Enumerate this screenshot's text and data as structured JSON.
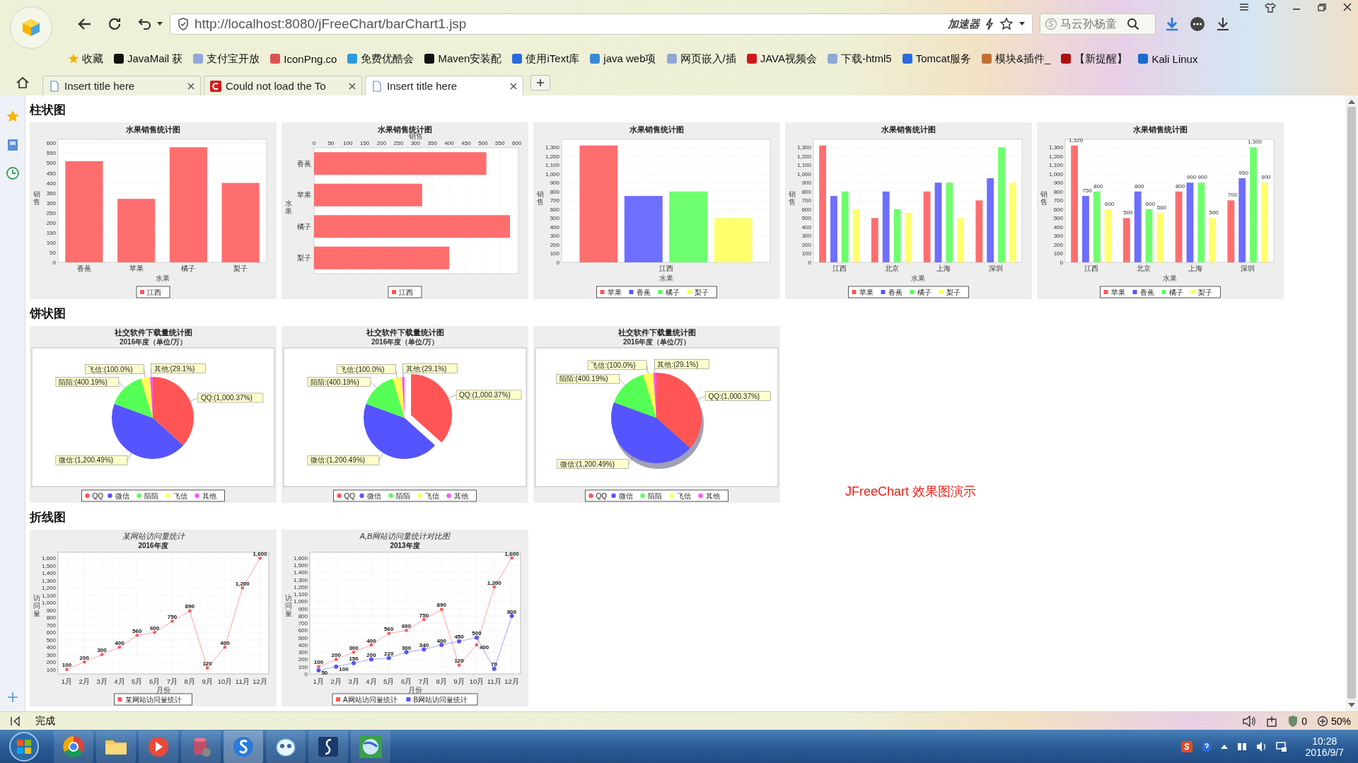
{
  "browser": {
    "address": "http://localhost:8080/jFreeChart/barChart1.jsp",
    "accelerator": "加速器",
    "search": {
      "placeholder": "马云孙杨童"
    },
    "bookmarks": [
      {
        "label": "收藏",
        "kind": "star",
        "color": "#f0b400"
      },
      {
        "label": "JavaMail 获",
        "kind": "site",
        "color": "#111111"
      },
      {
        "label": "支付宝开放",
        "kind": "site",
        "color": "#8fa8d8"
      },
      {
        "label": "IconPng.co",
        "kind": "site",
        "color": "#e05050"
      },
      {
        "label": "免费优酷会",
        "kind": "site",
        "color": "#2a9ae0"
      },
      {
        "label": "Maven安装配",
        "kind": "site",
        "color": "#111111"
      },
      {
        "label": "使用iText库",
        "kind": "site",
        "color": "#2a6ae0"
      },
      {
        "label": "java web项",
        "kind": "site",
        "color": "#3a8ad8"
      },
      {
        "label": "网页嵌入/插",
        "kind": "site",
        "color": "#8fa8d8"
      },
      {
        "label": "JAVA视频会",
        "kind": "site",
        "color": "#d01818"
      },
      {
        "label": "下载-html5",
        "kind": "site",
        "color": "#8fa8d8"
      },
      {
        "label": "Tomcat服务",
        "kind": "site",
        "color": "#2a6ae0"
      },
      {
        "label": "模块&插件_",
        "kind": "site",
        "color": "#c07030"
      },
      {
        "label": "【新提醒】",
        "kind": "site",
        "color": "#b01010"
      },
      {
        "label": "Kali Linux",
        "kind": "site",
        "color": "#1a6ad0"
      }
    ],
    "tabs": [
      {
        "title": "Insert title here",
        "kind": "page",
        "selected": false
      },
      {
        "title": "Could not load the To",
        "kind": "error",
        "selected": false
      },
      {
        "title": "Insert title here",
        "kind": "page",
        "selected": true
      }
    ]
  },
  "sections": [
    {
      "heading": "柱状图",
      "charts": [
        {
          "chart_data": {
            "type": "bar",
            "orientation": "vertical",
            "title": "水果销售统计图",
            "xlabel": "水果",
            "ylabel": "销售",
            "categories": [
              "香蕉",
              "苹果",
              "橘子",
              "梨子"
            ],
            "series": [
              {
                "name": "江西",
                "color": "#ff5555",
                "values": [
                  510,
                  320,
                  580,
                  400
                ]
              }
            ],
            "ylim": [
              0,
              620
            ],
            "yticks": [
              0,
              50,
              100,
              150,
              200,
              250,
              300,
              350,
              400,
              450,
              500,
              550,
              600
            ],
            "grid": true,
            "legend": "bottom"
          }
        },
        {
          "chart_data": {
            "type": "bar",
            "orientation": "horizontal",
            "title": "水果销售统计图",
            "xlabel": "销售",
            "ylabel": "水果",
            "categories": [
              "香蕉",
              "苹果",
              "橘子",
              "梨子"
            ],
            "series": [
              {
                "name": "江西",
                "color": "#ff5555",
                "values": [
                  510,
                  320,
                  580,
                  400
                ]
              }
            ],
            "xlim": [
              0,
              605
            ],
            "xticks": [
              0,
              50,
              100,
              150,
              200,
              250,
              300,
              350,
              400,
              450,
              500,
              550,
              600
            ],
            "grid": true,
            "legend": "bottom"
          }
        },
        {
          "chart_data": {
            "type": "bar",
            "orientation": "vertical",
            "title": "水果销售统计图",
            "xlabel": "水果",
            "ylabel": "销售",
            "categories": [
              "江西"
            ],
            "series": [
              {
                "name": "苹果",
                "color": "#ff5555",
                "values": [
                  1320
                ]
              },
              {
                "name": "香蕉",
                "color": "#5555ff",
                "values": [
                  750
                ]
              },
              {
                "name": "橘子",
                "color": "#55ff55",
                "values": [
                  800
                ]
              },
              {
                "name": "梨子",
                "color": "#ffff55",
                "values": [
                  500
                ]
              }
            ],
            "ylim": [
              0,
              1390
            ],
            "yticks": [
              0,
              100,
              200,
              300,
              400,
              500,
              600,
              700,
              800,
              900,
              {
                "value": 1000,
                "label": "1,000"
              },
              {
                "value": 1100,
                "label": "1,100"
              },
              {
                "value": 1200,
                "label": "1,200"
              },
              {
                "value": 1300,
                "label": "1,300"
              }
            ],
            "grid": true,
            "legend": "bottom"
          }
        },
        {
          "chart_data": {
            "type": "bar",
            "orientation": "vertical",
            "title": "水果销售统计图",
            "xlabel": "水果",
            "ylabel": "销售",
            "categories": [
              "江西",
              "北京",
              "上海",
              "深圳"
            ],
            "series": [
              {
                "name": "苹果",
                "color": "#ff5555",
                "values": [
                  1320,
                  500,
                  800,
                  700
                ]
              },
              {
                "name": "香蕉",
                "color": "#5555ff",
                "values": [
                  750,
                  800,
                  900,
                  950
                ]
              },
              {
                "name": "橘子",
                "color": "#55ff55",
                "values": [
                  800,
                  600,
                  900,
                  1300
                ]
              },
              {
                "name": "梨子",
                "color": "#ffff55",
                "values": [
                  600,
                  560,
                  500,
                  900
                ]
              }
            ],
            "ylim": [
              0,
              1390
            ],
            "yticks": [
              0,
              100,
              200,
              300,
              400,
              500,
              600,
              700,
              800,
              900,
              {
                "value": 1000,
                "label": "1,000"
              },
              {
                "value": 1100,
                "label": "1,100"
              },
              {
                "value": 1200,
                "label": "1,200"
              },
              {
                "value": 1300,
                "label": "1,300"
              }
            ],
            "grid": true,
            "legend": "bottom"
          }
        },
        {
          "chart_data": {
            "type": "bar",
            "orientation": "vertical",
            "title": "水果销售统计图",
            "xlabel": "水果",
            "ylabel": "销售",
            "categories": [
              "江西",
              "北京",
              "上海",
              "深圳"
            ],
            "series": [
              {
                "name": "苹果",
                "color": "#ff5555",
                "values": [
                  1320,
                  500,
                  800,
                  700
                ],
                "value_labels": [
                  "1,320",
                  "500",
                  "800",
                  "700"
                ]
              },
              {
                "name": "香蕉",
                "color": "#5555ff",
                "values": [
                  750,
                  800,
                  900,
                  950
                ],
                "value_labels": [
                  "750",
                  "800",
                  "900",
                  "950"
                ]
              },
              {
                "name": "橘子",
                "color": "#55ff55",
                "values": [
                  800,
                  600,
                  900,
                  1300
                ],
                "value_labels": [
                  "800",
                  "600",
                  "900",
                  "1,300"
                ]
              },
              {
                "name": "梨子",
                "color": "#ffff55",
                "values": [
                  600,
                  560,
                  500,
                  900
                ],
                "value_labels": [
                  "600",
                  "560",
                  "500",
                  "900"
                ]
              }
            ],
            "ylim": [
              0,
              1390
            ],
            "yticks": [
              0,
              100,
              200,
              300,
              400,
              500,
              600,
              700,
              800,
              900,
              {
                "value": 1000,
                "label": "1,000"
              },
              {
                "value": 1100,
                "label": "1,100"
              },
              {
                "value": 1200,
                "label": "1,200"
              },
              {
                "value": 1300,
                "label": "1,300"
              }
            ],
            "grid": true,
            "legend": "bottom"
          }
        }
      ]
    },
    {
      "heading": "饼状图",
      "note": "JFreeChart 效果图演示",
      "charts": [
        {
          "kind": "flat",
          "subtitle": "2016年度（单位/万）",
          "chart_data": {
            "type": "pie",
            "title": "社交软件下载量统计图",
            "categories": [
              "QQ",
              "微信",
              "陌陌",
              "飞信",
              "其他"
            ],
            "values": [
              1000.37,
              1200.49,
              400.19,
              100.0,
              29.1
            ],
            "value_labels": [
              "QQ:(1,000.37%)",
              "微信:(1,200.49%)",
              "陌陌:(400.19%)",
              "飞信:(100.0%)",
              "其他:(29.1%)"
            ],
            "legend": "bottom"
          },
          "slices": [
            {
              "color": "#ff5555"
            },
            {
              "color": "#5555ff"
            },
            {
              "color": "#55ff55"
            },
            {
              "color": "#ffff55"
            },
            {
              "color": "#ff55ff"
            }
          ]
        },
        {
          "kind": "exploded",
          "subtitle": "2016年度（单位/万）",
          "chart_data": {
            "type": "pie",
            "title": "社交软件下载量统计图",
            "categories": [
              "QQ",
              "微信",
              "陌陌",
              "飞信",
              "其他"
            ],
            "values": [
              1000.37,
              1200.49,
              400.19,
              100.0,
              29.1
            ],
            "value_labels": [
              "QQ:(1,000.37%)",
              "微信:(1,200.49%)",
              "陌陌:(400.19%)",
              "飞信:(100.0%)",
              "其他:(29.1%)"
            ],
            "legend": "bottom"
          },
          "slices": [
            {
              "color": "#ff5555"
            },
            {
              "color": "#5555ff"
            },
            {
              "color": "#55ff55"
            },
            {
              "color": "#ffff55"
            },
            {
              "color": "#ff55ff"
            }
          ]
        },
        {
          "kind": "tilted",
          "subtitle": "2016年度（单位/万）",
          "chart_data": {
            "type": "pie",
            "title": "社交软件下载量统计图",
            "categories": [
              "QQ",
              "微信",
              "陌陌",
              "飞信",
              "其他"
            ],
            "values": [
              1000.37,
              1200.49,
              400.19,
              100.0,
              29.1
            ],
            "value_labels": [
              "QQ:(1,000.37%)",
              "微信:(1,200.49%)",
              "陌陌:(400.19%)",
              "飞信:(100.0%)",
              "其他:(29.1%)"
            ],
            "legend": "bottom"
          },
          "slices": [
            {
              "color": "#ff5555"
            },
            {
              "color": "#5555ff"
            },
            {
              "color": "#55ff55"
            },
            {
              "color": "#ffff55"
            },
            {
              "color": "#ff55ff"
            }
          ]
        }
      ]
    },
    {
      "heading": "折线图",
      "charts": [
        {
          "subtitle": "2016年度",
          "chart_data": {
            "type": "line",
            "title": "某网站访问量统计",
            "xlabel": "月份",
            "ylabel": "访问量",
            "x": [
              "1月",
              "2月",
              "3月",
              "4月",
              "5月",
              "6月",
              "7月",
              "8月",
              "9月",
              "10月",
              "11月",
              "12月"
            ],
            "series": [
              {
                "name": "某网站访问量统计",
                "color": "#ff5555",
                "marker": "square",
                "values": [
                  100,
                  200,
                  300,
                  400,
                  560,
                  600,
                  750,
                  890,
                  120,
                  400,
                  1200,
                  1600
                ],
                "value_labels": [
                  "100",
                  "200",
                  "300",
                  "400",
                  "560",
                  "600",
                  "750",
                  "890",
                  "120",
                  "400",
                  "1,200",
                  "1,600"
                ]
              }
            ],
            "ylim": [
              40,
              1680
            ],
            "yticks": [
              100,
              200,
              300,
              400,
              500,
              600,
              700,
              800,
              900,
              {
                "value": 1000,
                "label": "1,000"
              },
              {
                "value": 1100,
                "label": "1,100"
              },
              {
                "value": 1200,
                "label": "1,200"
              },
              {
                "value": 1300,
                "label": "1,300"
              },
              {
                "value": 1400,
                "label": "1,400"
              },
              {
                "value": 1500,
                "label": "1,500"
              },
              {
                "value": 1600,
                "label": "1,600"
              }
            ],
            "grid": true,
            "legend": "bottom"
          }
        },
        {
          "subtitle": "2013年度",
          "chart_data": {
            "type": "line",
            "title": "A,B网站访问量统计对比图",
            "xlabel": "月份",
            "ylabel": "访问量",
            "x": [
              "1月",
              "2月",
              "3月",
              "4月",
              "5月",
              "6月",
              "7月",
              "8月",
              "9月",
              "10月",
              "11月",
              "12月"
            ],
            "series": [
              {
                "name": "A网站访问量统计",
                "color": "#ff5555",
                "marker": "square",
                "values": [
                  100,
                  200,
                  300,
                  400,
                  560,
                  600,
                  750,
                  890,
                  120,
                  400,
                  1200,
                  1600
                ],
                "value_labels": [
                  "100",
                  "200",
                  "300",
                  "400",
                  "560",
                  "600",
                  "750",
                  "890",
                  "120",
                  "400",
                  "1,200",
                  "1,600"
                ]
              },
              {
                "name": "B网站访问量统计",
                "color": "#5555ff",
                "marker": "circle",
                "values": [
                  50,
                  100,
                  150,
                  200,
                  220,
                  300,
                  340,
                  400,
                  450,
                  500,
                  70,
                  800
                ],
                "value_labels": [
                  "50",
                  "100",
                  "150",
                  "200",
                  "220",
                  "300",
                  "340",
                  "400",
                  "450",
                  "500",
                  "70",
                  "800"
                ]
              }
            ],
            "ylim": [
              0,
              1680
            ],
            "yticks": [
              0,
              100,
              200,
              300,
              400,
              500,
              600,
              700,
              800,
              900,
              {
                "value": 1000,
                "label": "1,000"
              },
              {
                "value": 1100,
                "label": "1,100"
              },
              {
                "value": 1200,
                "label": "1,200"
              },
              {
                "value": 1300,
                "label": "1,300"
              },
              {
                "value": 1400,
                "label": "1,400"
              },
              {
                "value": 1500,
                "label": "1,500"
              },
              {
                "value": 1600,
                "label": "1,600"
              }
            ],
            "grid": true,
            "legend": "bottom"
          }
        }
      ]
    }
  ],
  "status_bar": {
    "text": "完成",
    "count": "0",
    "zoom": "50%"
  },
  "taskbar": {
    "time": "10:28",
    "date": "2016/9/7"
  }
}
